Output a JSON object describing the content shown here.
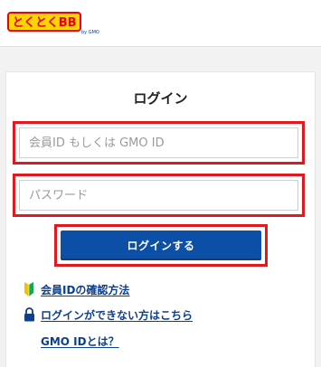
{
  "header": {
    "logo_text": "とくとくBB",
    "logo_suffix": "by GMO"
  },
  "login": {
    "title": "ログイン",
    "member_id_placeholder": "会員ID もしくは GMO ID",
    "password_placeholder": "パスワード",
    "submit_label": "ログインする"
  },
  "links": [
    {
      "label": "会員IDの確認方法",
      "icon": "beginner-mark-icon"
    },
    {
      "label": "ログインができない方はこちら",
      "icon": "lock-icon"
    },
    {
      "label": "GMO IDとは？",
      "icon": ""
    }
  ],
  "colors": {
    "primary_button": "#0b4fa6",
    "highlight_border": "#e0181f",
    "link": "#0b3f8f",
    "logo_yellow": "#ffd400",
    "logo_red": "#e60012"
  }
}
